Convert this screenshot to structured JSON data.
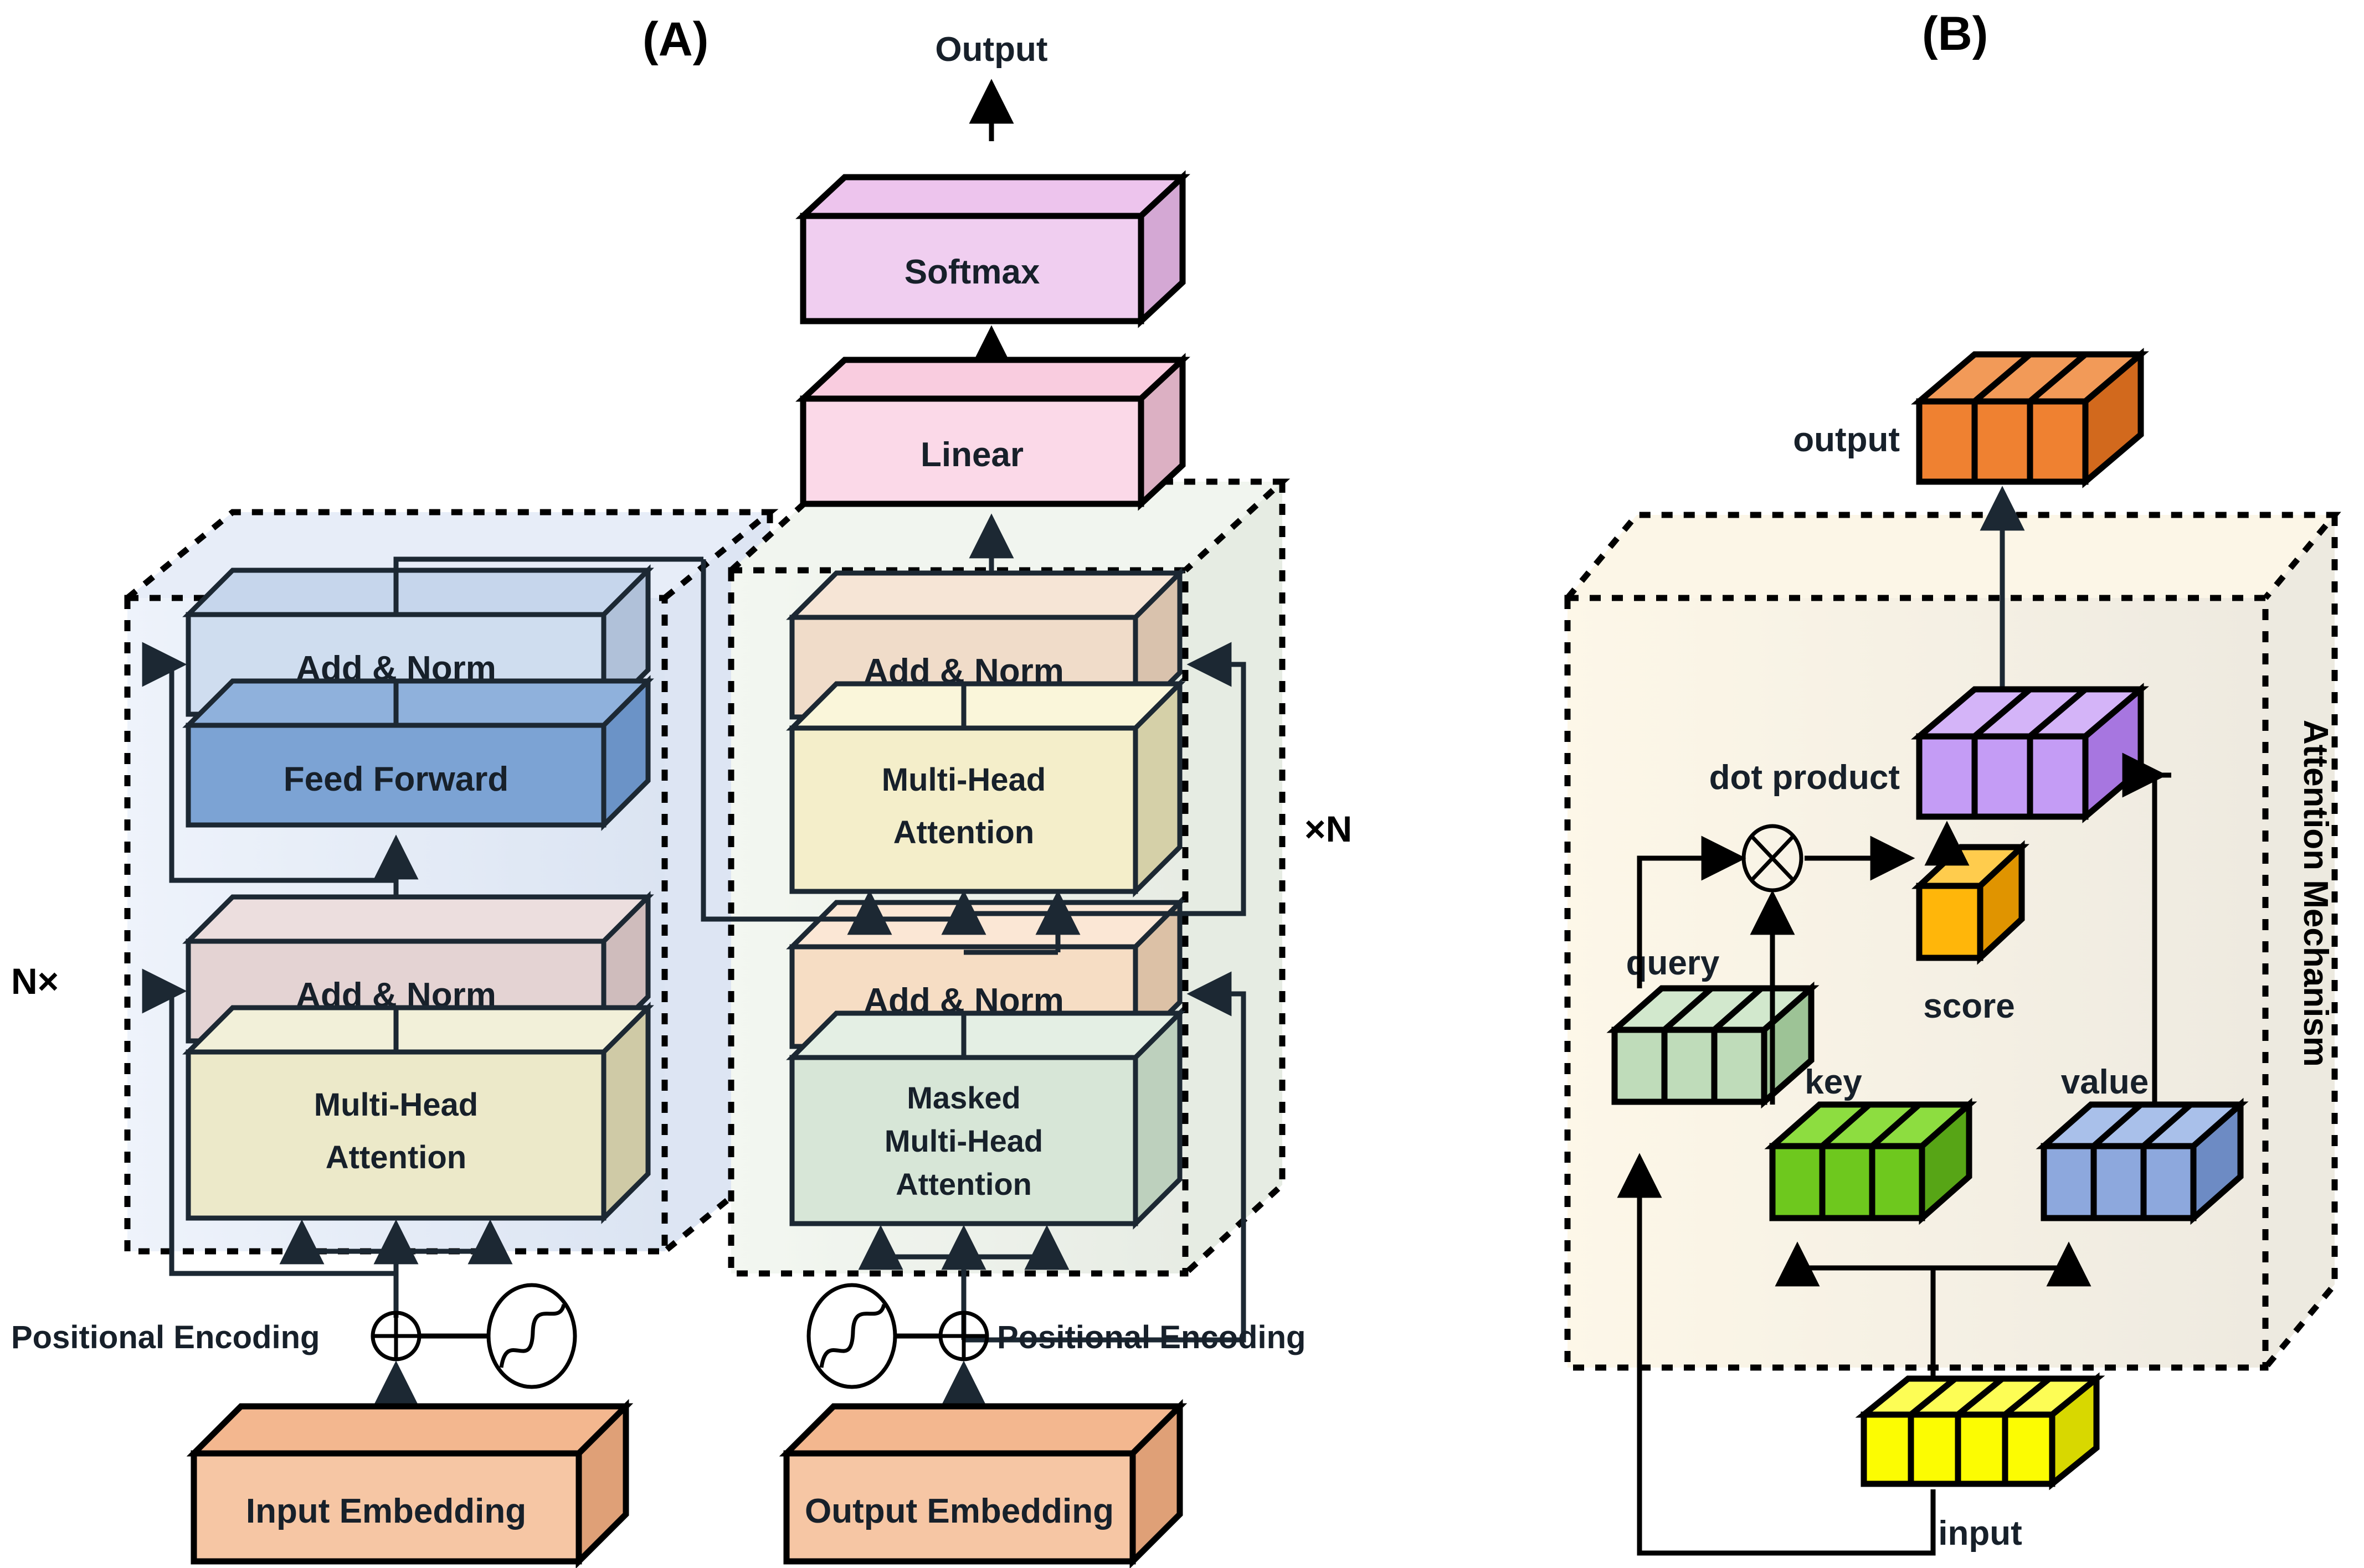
{
  "panels": {
    "a_label": "(A)",
    "b_label": "(B)"
  },
  "encoder": {
    "repeat_label": "N×",
    "blocks": [
      {
        "label": "Add & Norm",
        "color": "#cfddef"
      },
      {
        "label": "Feed Forward",
        "color": "#7ca3d4"
      },
      {
        "label": "Add & Norm",
        "color": "#e4d3d3"
      },
      {
        "label": "Multi-Head\nAttention",
        "line1": "Multi-Head",
        "line2": "Attention",
        "color": "#ece9c9"
      }
    ],
    "positional_encoding_label": "Positional Encoding",
    "embedding_label": "Input Embedding",
    "embedding_color": "#f6c6a4",
    "container_color": "#eaf0fa"
  },
  "decoder": {
    "repeat_label": "×N",
    "output_label": "Output",
    "blocks": [
      {
        "label": "Softmax",
        "color": "#f0cef0"
      },
      {
        "label": "Linear",
        "color": "#fbd9e8"
      },
      {
        "label": "Add & Norm",
        "color": "#f0dcc9"
      },
      {
        "line1": "Multi-Head",
        "line2": "Attention",
        "color": "#f4eeca"
      },
      {
        "label": "Add & Norm",
        "color": "#f6ddc4"
      },
      {
        "line1": "Masked",
        "line2": "Multi-Head",
        "line3": "Attention",
        "color": "#d7e6d7"
      }
    ],
    "positional_encoding_label": "Positional Encoding",
    "embedding_label": "Output Embedding",
    "embedding_color": "#f6c6a4",
    "container_color": "#f0f4ee"
  },
  "attention": {
    "title": "Attention Mechanism",
    "container_color": "#fdf7e8",
    "vectors": [
      {
        "name": "output",
        "cells": 3,
        "color": "#ef8131",
        "top": "#f29a58",
        "side": "#d2691d"
      },
      {
        "name": "dot product",
        "cells": 3,
        "color": "#c49cf5",
        "top": "#d4b4f8",
        "side": "#a776e0"
      },
      {
        "name": "score",
        "cells": 1,
        "color": "#ffb60a",
        "top": "#ffcc4d",
        "side": "#e09400"
      },
      {
        "name": "query",
        "cells": 3,
        "color": "#bfdcba",
        "top": "#d2e8cd",
        "side": "#9dc396"
      },
      {
        "name": "key",
        "cells": 3,
        "color": "#6ec81e",
        "top": "#8ddd40",
        "side": "#57a516"
      },
      {
        "name": "value",
        "cells": 3,
        "color": "#8da8dd",
        "top": "#a9c0ea",
        "side": "#6d8bc4"
      },
      {
        "name": "input",
        "cells": 4,
        "color": "#fcfc02",
        "top": "#fdfd55",
        "side": "#d8d800"
      }
    ],
    "operator_multiply": "⊗",
    "operator_add": "⊕"
  }
}
